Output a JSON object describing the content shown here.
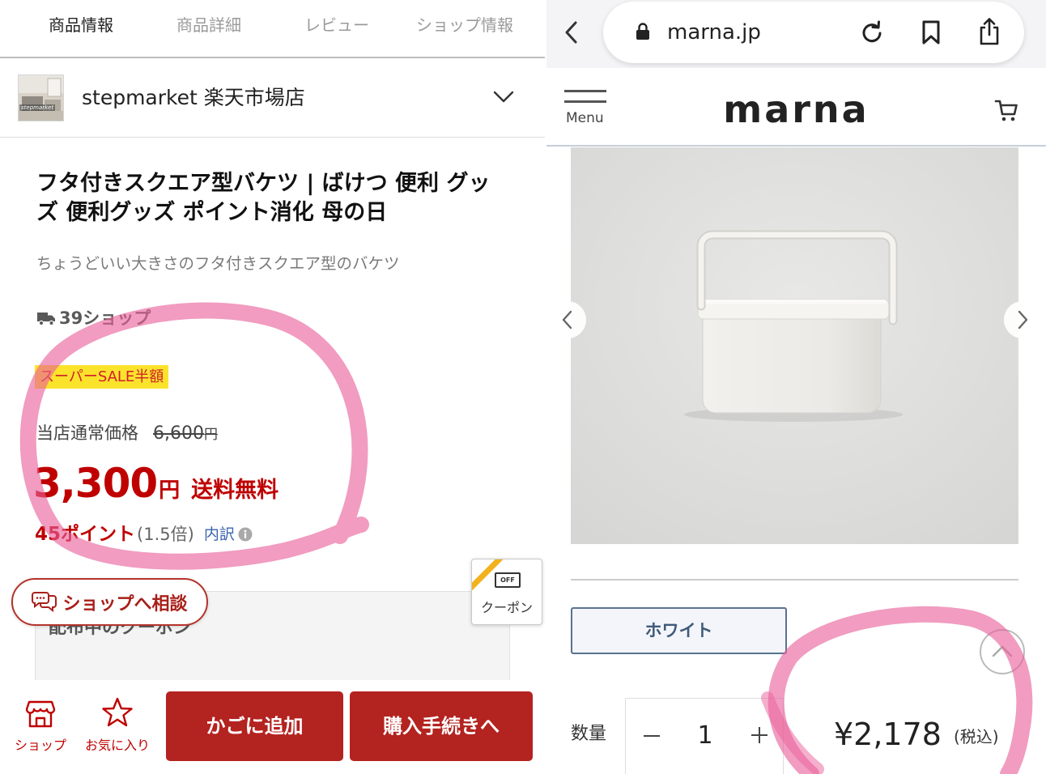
{
  "rakuten": {
    "tabs": [
      {
        "label": "商品情報",
        "active": true
      },
      {
        "label": "商品詳細",
        "active": false
      },
      {
        "label": "レビュー",
        "active": false
      },
      {
        "label": "ショップ情報",
        "active": false
      }
    ],
    "shop": {
      "name": "stepmarket 楽天市場店",
      "thumb_label": "stepmarket"
    },
    "product": {
      "title": "フタ付きスクエア型バケツ | ばけつ 便利 グッズ 便利グッズ ポイント消化 母の日",
      "subtitle": "ちょうどいい大きさのフタ付きスクエア型のバケツ",
      "shop_count": "39ショップ",
      "sale_badge": "スーパーSALE半額",
      "regular_price_label": "当店通常価格",
      "regular_price": "6,600",
      "regular_price_currency": "円",
      "price": "3,300",
      "price_currency": "円",
      "shipping": "送料無料",
      "points": "45ポイント",
      "points_rate": "(1.5倍)",
      "points_breakdown": "内訳"
    },
    "coupon": {
      "icon_label": "OFF",
      "label": "クーポン"
    },
    "coupon_panel_title": "配布中のクーポン",
    "consult_button": "ショップへ相談",
    "bottom_bar": {
      "shop": "ショップ",
      "favorite": "お気に入り",
      "add_to_cart": "かごに追加",
      "checkout": "購入手続きへ"
    },
    "colors": {
      "brand_red": "#bf0000",
      "button_red": "#b32320",
      "badge_yellow": "#fbe32c",
      "link_blue": "#3a65ae"
    }
  },
  "marna": {
    "browser": {
      "url": "marna.jp"
    },
    "header": {
      "menu_label": "Menu",
      "logo": "marna"
    },
    "product": {
      "color_option": "ホワイト",
      "quantity_label": "数量",
      "quantity": "1",
      "price": "¥2,178",
      "tax_note": "(税込)"
    },
    "icons": [
      "chevron-left-icon",
      "lock-icon",
      "reload-icon",
      "bookmark-icon",
      "share-icon",
      "hamburger-menu-icon",
      "cart-icon",
      "carousel-prev-icon",
      "carousel-next-icon",
      "scroll-top-icon",
      "minus-icon",
      "plus-icon"
    ],
    "colors": {
      "accent_blue": "#3f5a7a",
      "header_border": "#c6cfdb"
    }
  },
  "annotation_color": "#e9609a"
}
